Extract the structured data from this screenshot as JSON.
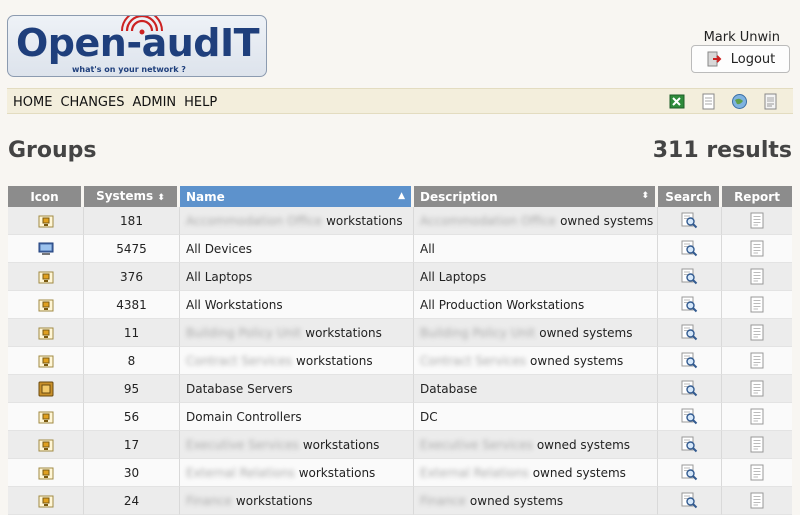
{
  "app": {
    "logo_text": "Open-audIT",
    "logo_tagline": "what's on your network ?"
  },
  "user": {
    "name": "Mark Unwin",
    "logout_label": "Logout"
  },
  "menu": {
    "items": [
      "HOME",
      "CHANGES",
      "ADMIN",
      "HELP"
    ]
  },
  "toolbar_icons": [
    "excel-export-icon",
    "document-export-icon",
    "web-export-icon",
    "printer-export-icon"
  ],
  "page": {
    "title": "Groups",
    "results": "311 results"
  },
  "table": {
    "columns": [
      "Icon",
      "Systems",
      "Name",
      "Description",
      "Search",
      "Report"
    ],
    "rows": [
      {
        "icon": "workstation-group-icon",
        "systems": "181",
        "name_prefix": "Accommodation Office",
        "name": "workstations",
        "desc_prefix": "Accommodation Office",
        "desc": "owned systems"
      },
      {
        "icon": "computer-icon",
        "systems": "5475",
        "name_prefix": "",
        "name": "All Devices",
        "desc_prefix": "",
        "desc": "All"
      },
      {
        "icon": "workstation-group-icon",
        "systems": "376",
        "name_prefix": "",
        "name": "All Laptops",
        "desc_prefix": "",
        "desc": "All Laptops"
      },
      {
        "icon": "workstation-group-icon",
        "systems": "4381",
        "name_prefix": "",
        "name": "All Workstations",
        "desc_prefix": "",
        "desc": "All Production Workstations"
      },
      {
        "icon": "workstation-group-icon",
        "systems": "11",
        "name_prefix": "Building Policy Unit",
        "name": "workstations",
        "desc_prefix": "Building Policy Unit",
        "desc": "owned systems"
      },
      {
        "icon": "workstation-group-icon",
        "systems": "8",
        "name_prefix": "Contract Services",
        "name": "workstations",
        "desc_prefix": "Contract Services",
        "desc": "owned systems"
      },
      {
        "icon": "database-server-icon",
        "systems": "95",
        "name_prefix": "",
        "name": "Database Servers",
        "desc_prefix": "",
        "desc": "Database"
      },
      {
        "icon": "workstation-group-icon",
        "systems": "56",
        "name_prefix": "",
        "name": "Domain Controllers",
        "desc_prefix": "",
        "desc": "DC"
      },
      {
        "icon": "workstation-group-icon",
        "systems": "17",
        "name_prefix": "Executive Services",
        "name": "workstations",
        "desc_prefix": "Executive Services",
        "desc": "owned systems"
      },
      {
        "icon": "workstation-group-icon",
        "systems": "30",
        "name_prefix": "External Relations",
        "name": "workstations",
        "desc_prefix": "External Relations",
        "desc": "owned systems"
      },
      {
        "icon": "workstation-group-icon",
        "systems": "24",
        "name_prefix": "Finance",
        "name": "workstations",
        "desc_prefix": "Finance",
        "desc": "owned systems"
      }
    ]
  },
  "colors": {
    "header_gray": "#8c8c8c",
    "header_active": "#5d92cc",
    "navbar": "#f3eedc",
    "logo_blue": "#1f3f7c",
    "logo_red": "#cc2222"
  }
}
